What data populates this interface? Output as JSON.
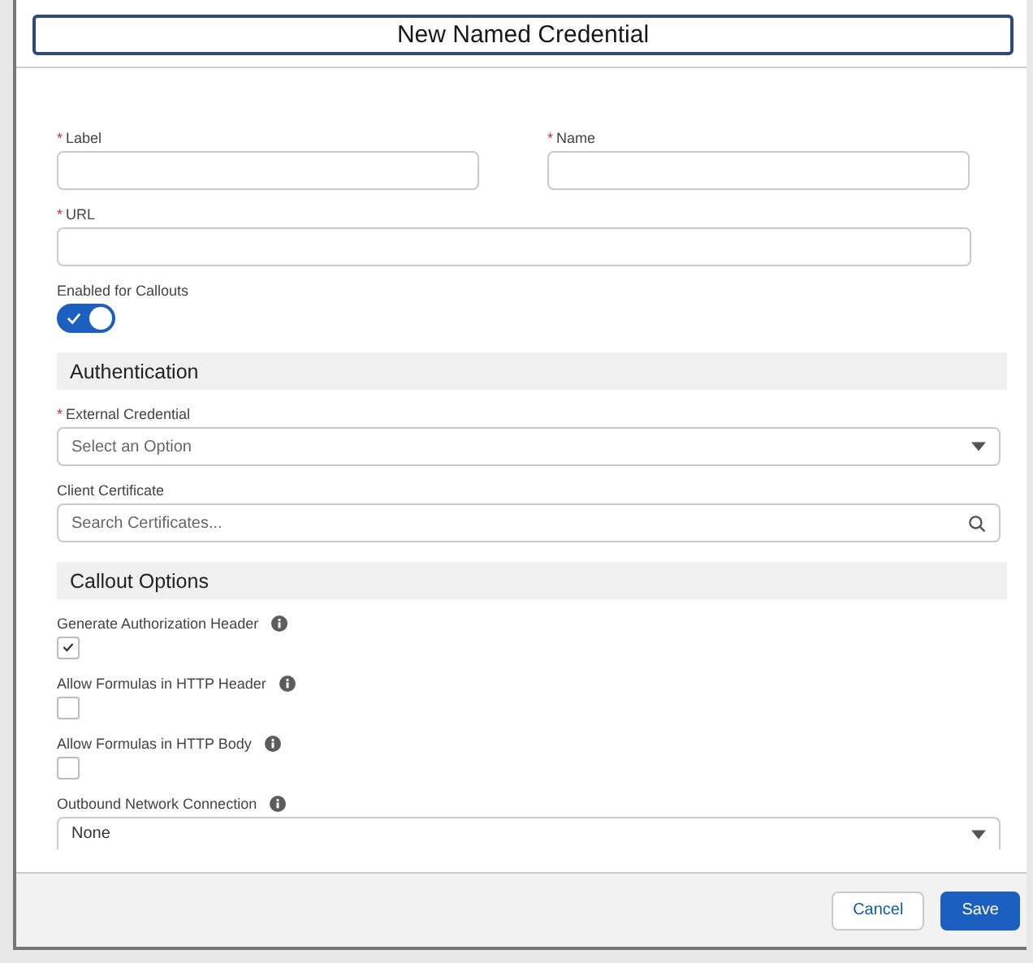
{
  "modal": {
    "title": "New Named Credential"
  },
  "rows": [
    {
      "fields": [
        {
          "kind": "text",
          "label": "Label",
          "required_mark": "*"
        },
        {
          "kind": "text",
          "label": "Name",
          "required_mark": "*"
        }
      ]
    },
    {
      "fields": [
        {
          "kind": "text",
          "label": "URL",
          "required_mark": "*"
        }
      ]
    },
    {
      "fields": [
        {
          "kind": "toggle",
          "label": "Enabled for Callouts",
          "on": true
        }
      ]
    },
    {
      "fields": [
        {
          "kind": "section",
          "label": "Authentication"
        }
      ]
    },
    {
      "fields": [
        {
          "kind": "combobox",
          "label": "External Credential",
          "required_mark": "*",
          "placeholder": "Select an Option"
        }
      ]
    },
    {
      "fields": [
        {
          "kind": "search",
          "label": "Client Certificate",
          "placeholder": "Search Certificates..."
        }
      ]
    },
    {
      "fields": [
        {
          "kind": "section",
          "label": "Callout Options"
        }
      ]
    },
    {
      "fields": [
        {
          "kind": "checkbox",
          "label": "Generate Authorization Header",
          "info": true,
          "checked": true
        }
      ]
    },
    {
      "fields": [
        {
          "kind": "checkbox",
          "label": "Allow Formulas in HTTP Header",
          "info": true,
          "checked": false
        }
      ]
    },
    {
      "fields": [
        {
          "kind": "checkbox",
          "label": "Allow Formulas in HTTP Body",
          "info": true,
          "checked": false
        }
      ]
    },
    {
      "fields": [
        {
          "kind": "combobox",
          "label": "Outbound Network Connection",
          "info": true,
          "value": "None"
        }
      ]
    }
  ],
  "footer": {
    "buttons": [
      {
        "label": "Cancel",
        "kind": "neutral"
      },
      {
        "label": "Save",
        "kind": "brand"
      }
    ]
  }
}
